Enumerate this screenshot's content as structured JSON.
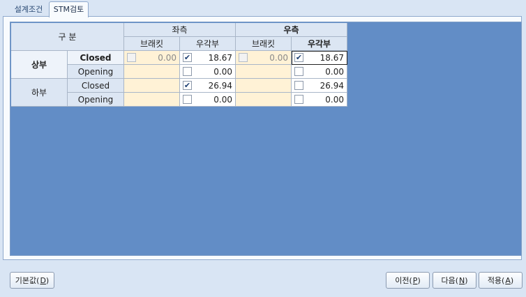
{
  "tabs": [
    "설계조건",
    "STM검토"
  ],
  "grid": {
    "corner_label": "구    분",
    "groups": [
      "좌측",
      "우측"
    ],
    "subheaders": [
      "브래킷",
      "우각부",
      "브래킷",
      "우각부"
    ],
    "sections": [
      {
        "label": "상부",
        "rows": [
          {
            "label": "Closed",
            "values": [
              "0.00",
              "18.67",
              "0.00",
              "18.67"
            ],
            "checked": [
              false,
              true,
              false,
              true
            ]
          },
          {
            "label": "Opening",
            "values": [
              "",
              "0.00",
              "",
              "0.00"
            ],
            "checked": [
              false,
              false,
              false,
              false
            ]
          }
        ]
      },
      {
        "label": "하부",
        "rows": [
          {
            "label": "Closed",
            "values": [
              "",
              "26.94",
              "",
              "26.94"
            ],
            "checked": [
              false,
              true,
              false,
              false
            ]
          },
          {
            "label": "Opening",
            "values": [
              "",
              "0.00",
              "",
              "0.00"
            ],
            "checked": [
              false,
              false,
              false,
              false
            ]
          }
        ]
      }
    ]
  },
  "buttons": {
    "default": {
      "text": "기본값(",
      "key": "D",
      "suffix": ")"
    },
    "prev": {
      "text": "이전(",
      "key": "P",
      "suffix": ")"
    },
    "next": {
      "text": "다음(",
      "key": "N",
      "suffix": ")"
    },
    "apply": {
      "text": "적용(",
      "key": "A",
      "suffix": ")"
    }
  },
  "icons": {
    "check": "check-mark-icon"
  }
}
